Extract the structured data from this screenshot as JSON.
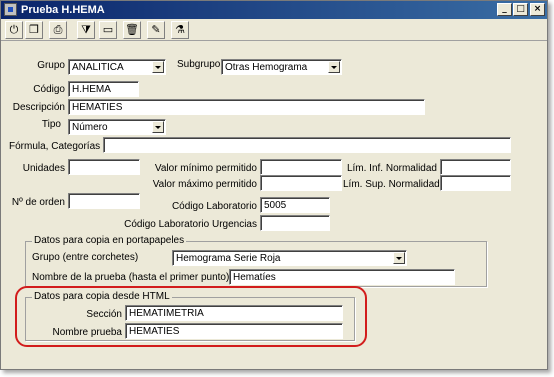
{
  "window": {
    "title": "Prueba H.HEMA",
    "min_symbol": "_",
    "max_symbol": "□",
    "close_symbol": "×"
  },
  "toolbar": {
    "tools": [
      {
        "name": "exit-tool-icon",
        "glyph": "⏻"
      },
      {
        "name": "copy-tool-icon",
        "glyph": "❐"
      },
      {
        "name": "print-tool-icon",
        "glyph": "⎙"
      },
      {
        "name": "filter-tool-icon",
        "glyph": "⧩"
      },
      {
        "name": "folder-tool-icon",
        "glyph": "▭"
      },
      {
        "name": "delete-tool-icon",
        "glyph": "🗑"
      },
      {
        "name": "edit-tool-icon",
        "glyph": "✎"
      },
      {
        "name": "lab-tool-icon",
        "glyph": "⚗"
      }
    ]
  },
  "form": {
    "grupo": {
      "label": "Grupo",
      "value": "ANALITICA"
    },
    "subgrupo": {
      "label": "Subgrupo",
      "value": "Otras Hemograma"
    },
    "codigo": {
      "label": "Código",
      "value": "H.HEMA"
    },
    "descripcion": {
      "label": "Descripción",
      "value": "HEMATIES"
    },
    "tipo": {
      "label": "Tipo",
      "value": "Número"
    },
    "formula": {
      "label": "Fórmula, Categorías",
      "value": ""
    },
    "unidades": {
      "label": "Unidades",
      "value": ""
    },
    "valor_min": {
      "label": "Valor mínimo permitido",
      "value": ""
    },
    "valor_max": {
      "label": "Valor máximo permitido",
      "value": ""
    },
    "lim_inf": {
      "label": "Lím. Inf. Normalidad",
      "value": ""
    },
    "lim_sup": {
      "label": "Lím. Sup. Normalidad",
      "value": ""
    },
    "orden": {
      "label": "Nº de orden",
      "value": ""
    },
    "cod_lab": {
      "label": "Código Laboratorio",
      "value": "5005"
    },
    "cod_lab_urg": {
      "label": "Código Laboratorio Urgencias",
      "value": ""
    }
  },
  "portapapeles": {
    "title": "Datos para copia en portapapeles",
    "grupo": {
      "label": "Grupo (entre corchetes)",
      "value": "Hemograma Serie Roja"
    },
    "nombre": {
      "label": "Nombre de la prueba (hasta el primer punto)",
      "value": "Hematíes"
    }
  },
  "html_copy": {
    "title": "Datos para copia desde HTML",
    "seccion": {
      "label": "Sección",
      "value": "HEMATIMETRIA"
    },
    "nombre": {
      "label": "Nombre prueba",
      "value": "HEMATIES"
    }
  },
  "colors": {
    "highlight": "#d21c1c",
    "titlebar_start": "#0a246a",
    "titlebar_end": "#3a6ea5"
  }
}
